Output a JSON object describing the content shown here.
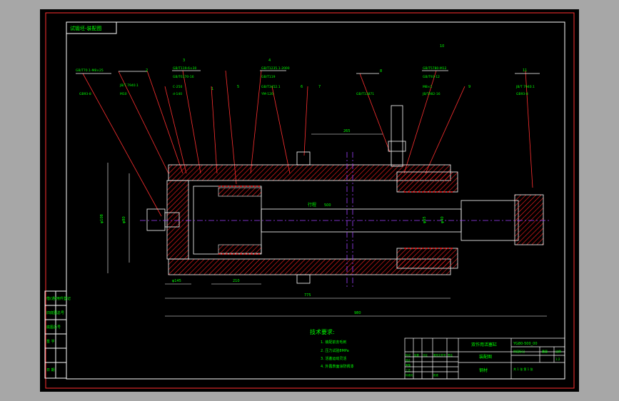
{
  "title_box": "试锻坯-装配图",
  "part_tags": [
    "1",
    "2",
    "3",
    "4",
    "5",
    "6",
    "7",
    "8",
    "9",
    "10",
    "11",
    "12",
    "13",
    "14",
    "15",
    "16",
    "17",
    "18"
  ],
  "callout_labels": [
    {
      "code": "GB/T70.1-M8×25",
      "sub": "GB93-8",
      "tag": "2"
    },
    {
      "code": "JB/T 7940.1",
      "sub": "M10",
      "tag": "3"
    },
    {
      "code": "GB/T119-6×30",
      "sub": "GB/T6170-16",
      "tag": "4"
    },
    {
      "code": "C-250",
      "sub": "d-140",
      "tag": "5"
    },
    {
      "code": "GB/T1235.1-2000",
      "sub": "GB/T119",
      "tag": "6"
    },
    {
      "code": "GB/T3452.1",
      "sub": "YM-120",
      "tag": "7"
    },
    {
      "code": "GB/T893.1-90",
      "sub": "GB/T13871",
      "tag": "8"
    },
    {
      "code": "GB/T5780-M12",
      "sub": "GB/T93-12",
      "tag": "9"
    },
    {
      "code": "M8×1",
      "sub": "JB/T982-16",
      "tag": "10"
    }
  ],
  "dims": {
    "d1": "φ108",
    "d2": "φ80",
    "d3": "φ65",
    "d4": "φ40",
    "d5": "φ145",
    "l1": "980",
    "l2": "775",
    "l3": "210",
    "l4": "265",
    "stroke": "行程",
    "stroke_val": "500"
  },
  "tech_title": "技术要求:",
  "tech_lines": [
    "1. 装配前去毛刺",
    "2. 压力试验8MPa",
    "3. 活塞运动灵活",
    "4. 外露表面涂防锈漆"
  ],
  "left_strip": [
    "借(通)用件登记",
    "旧底图总号",
    "底图总号",
    "签 字",
    "日 期"
  ],
  "title_block": {
    "name": "双作用活塞缸",
    "view": "装配图",
    "drawing_no": "YG80-500_00",
    "material": "钢材",
    "stage": "阶段标记",
    "weight": "重量",
    "scale": "比例",
    "scale_val": "1:2",
    "rev_headers": [
      "标记",
      "处数",
      "分区",
      "更改文件号",
      "签名",
      "年月日"
    ],
    "roles": [
      "设计",
      "审核",
      "工艺",
      "标准化",
      "批准"
    ],
    "sheet": "共 1 张  第 1 张"
  },
  "colors": {
    "outline": "#ffffff",
    "part": "#ff2020",
    "leader": "#ff3030",
    "text": "#00ff00",
    "centerline": "#a040ff",
    "dim": "#ffffff"
  }
}
